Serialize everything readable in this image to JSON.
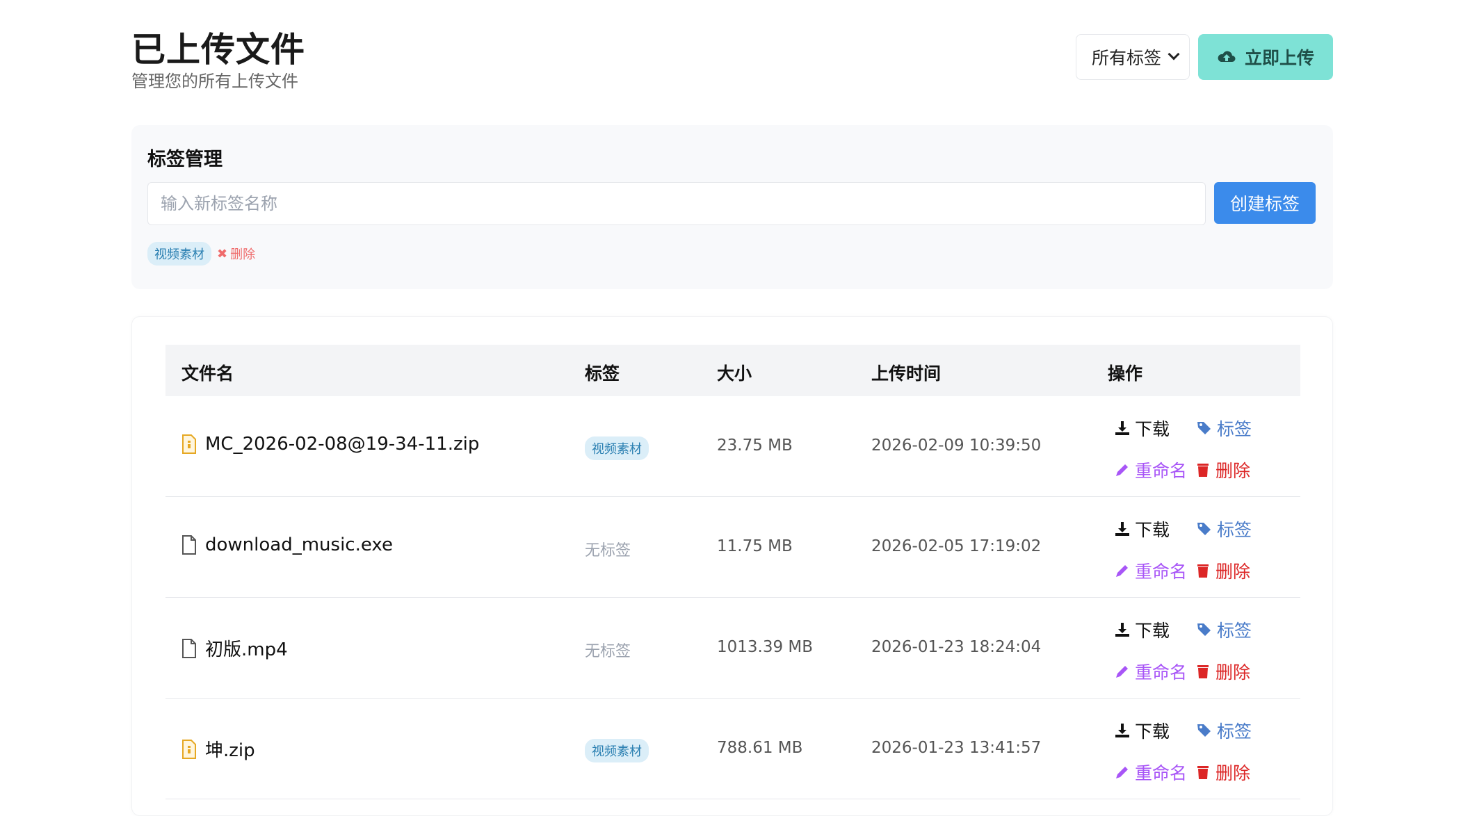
{
  "header": {
    "title": "已上传文件",
    "subtitle": "管理您的所有上传文件",
    "filter_selected": "所有标签",
    "upload_label": "立即上传"
  },
  "tag_management": {
    "title": "标签管理",
    "input_placeholder": "输入新标签名称",
    "create_label": "创建标签",
    "tags": [
      {
        "name": "视频素材",
        "delete_label": "删除"
      }
    ]
  },
  "table": {
    "columns": [
      "文件名",
      "标签",
      "大小",
      "上传时间",
      "操作"
    ],
    "actions": {
      "download": "下载",
      "tag": "标签",
      "rename": "重命名",
      "delete": "删除"
    },
    "no_tag_label": "无标签",
    "rows": [
      {
        "name": "MC_2026-02-08@19-34-11.zip",
        "icon": "zip-file-icon",
        "tag": "视频素材",
        "size": "23.75 MB",
        "time": "2026-02-09 10:39:50"
      },
      {
        "name": "download_music.exe",
        "icon": "file-icon",
        "tag": "",
        "size": "11.75 MB",
        "time": "2026-02-05 17:19:02"
      },
      {
        "name": "初版.mp4",
        "icon": "file-icon",
        "tag": "",
        "size": "1013.39 MB",
        "time": "2026-01-23 18:24:04"
      },
      {
        "name": "坤.zip",
        "icon": "zip-file-icon",
        "tag": "视频素材",
        "size": "788.61 MB",
        "time": "2026-01-23 13:41:57"
      }
    ]
  },
  "colors": {
    "upload_button": "#7ee2d6",
    "create_button": "#3b8beb",
    "tag_badge_bg": "#dbeef8",
    "tag_badge_text": "#2a7fb1",
    "rename": "#a855f7",
    "delete": "#dc2626",
    "tag_action": "#4a7cc9"
  }
}
